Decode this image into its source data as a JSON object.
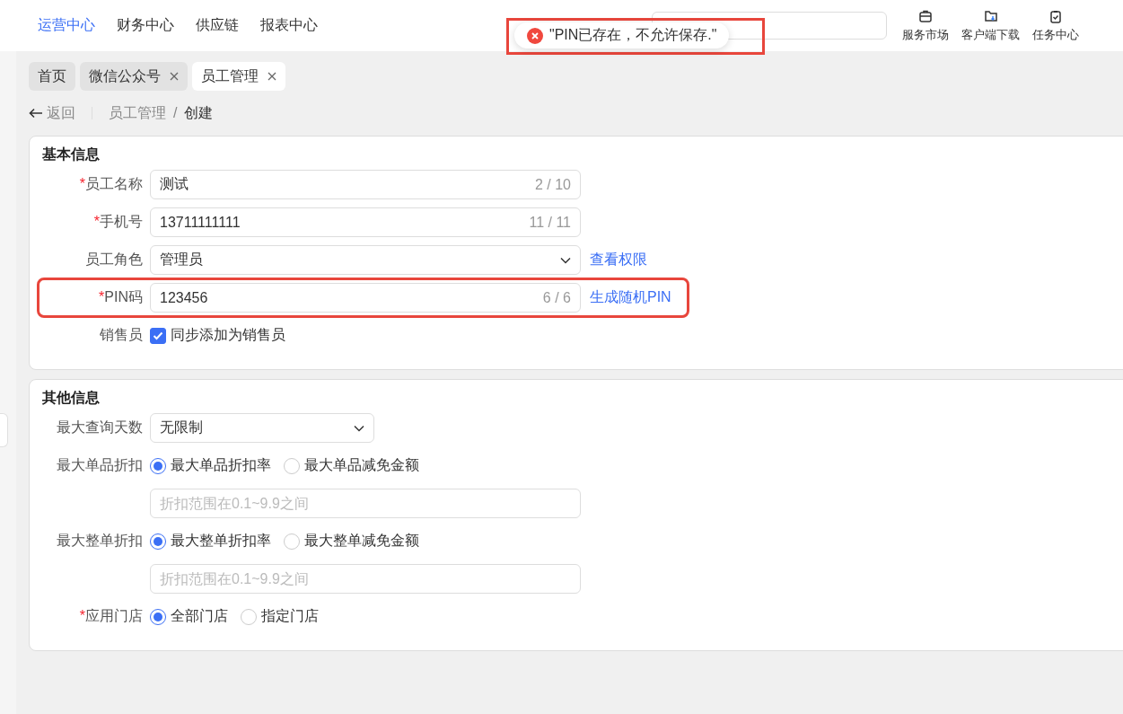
{
  "nav": {
    "items": [
      {
        "label": "运营中心",
        "selected": true
      },
      {
        "label": "财务中心",
        "selected": false
      },
      {
        "label": "供应链",
        "selected": false
      },
      {
        "label": "报表中心",
        "selected": false
      }
    ],
    "tools": [
      {
        "kind": "briefcase",
        "label": "服务市场"
      },
      {
        "kind": "folder-download",
        "label": "客户端下载"
      },
      {
        "kind": "clipboard-check",
        "label": "任务中心"
      }
    ]
  },
  "toast": {
    "message": "\"PIN已存在，不允许保存.\"",
    "highlighted": true
  },
  "tabs": [
    {
      "label": "首页",
      "selected": false,
      "closable": false
    },
    {
      "label": "微信公众号",
      "selected": false,
      "closable": true
    },
    {
      "label": "员工管理",
      "selected": true,
      "closable": true
    }
  ],
  "breadcrumb": {
    "back": "返回",
    "separator": "/",
    "items": [
      "员工管理",
      "创建"
    ]
  },
  "sections": [
    {
      "title": "基本信息",
      "fields": [
        {
          "kind": "text",
          "label": "员工名称",
          "required_mark": "*",
          "value": "测试",
          "counter": "2 / 10",
          "highlighted": false
        },
        {
          "kind": "text",
          "label": "手机号",
          "required_mark": "*",
          "value": "13711111111",
          "counter": "11 / 11",
          "highlighted": false
        },
        {
          "kind": "select",
          "label": "员工角色",
          "value": "管理员",
          "link": "查看权限"
        },
        {
          "kind": "text",
          "label": "PIN码",
          "required_mark": "*",
          "value": "123456",
          "counter": "6 / 6",
          "link": "生成随机PIN",
          "highlighted": true
        },
        {
          "kind": "checkbox",
          "label": "销售员",
          "option": "同步添加为销售员",
          "checked": true
        }
      ]
    },
    {
      "title": "其他信息",
      "fields": [
        {
          "kind": "short-select",
          "label": "最大查询天数",
          "value": "无限制"
        },
        {
          "kind": "radio",
          "label": "最大单品折扣",
          "options": [
            {
              "label": "最大单品折扣率",
              "selected": true
            },
            {
              "label": "最大单品减免金额",
              "selected": false
            }
          ],
          "placeholder": "折扣范围在0.1~9.9之间"
        },
        {
          "kind": "radio",
          "label": "最大整单折扣",
          "options": [
            {
              "label": "最大整单折扣率",
              "selected": true
            },
            {
              "label": "最大整单减免金额",
              "selected": false
            }
          ],
          "placeholder": "折扣范围在0.1~9.9之间"
        },
        {
          "kind": "radio",
          "label": "应用门店",
          "required_mark": "*",
          "options": [
            {
              "label": "全部门店",
              "selected": true
            },
            {
              "label": "指定门店",
              "selected": false
            }
          ]
        }
      ]
    }
  ]
}
